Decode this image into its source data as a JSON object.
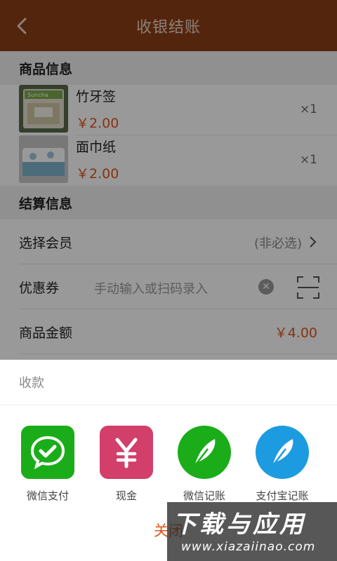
{
  "header": {
    "title": "收银结账"
  },
  "goods_section": {
    "title": "商品信息",
    "items": [
      {
        "name": "竹牙签",
        "price": "￥2.00",
        "qty": "×1"
      },
      {
        "name": "面巾纸",
        "price": "￥2.00",
        "qty": "×1"
      }
    ]
  },
  "settle_section": {
    "title": "结算信息",
    "member": {
      "label": "选择会员",
      "hint": "(非必选)"
    },
    "coupon": {
      "label": "优惠券",
      "placeholder": "手动输入或扫码录入"
    },
    "amount": {
      "label": "商品金额",
      "value": "￥4.00"
    }
  },
  "sheet": {
    "title": "收款",
    "options": [
      {
        "label": "微信支付",
        "icon": "wechat-pay-icon",
        "color": "#1aad19"
      },
      {
        "label": "现金",
        "icon": "yen-icon",
        "color": "#d23f6a"
      },
      {
        "label": "微信记账",
        "icon": "feather-icon",
        "color": "#1aad19"
      },
      {
        "label": "支付宝记账",
        "icon": "feather-icon",
        "color": "#1d9be0"
      }
    ],
    "close_label": "关闭"
  },
  "watermark": {
    "line1": "下载与应用",
    "line2": "www.xiazaiinao.com"
  }
}
